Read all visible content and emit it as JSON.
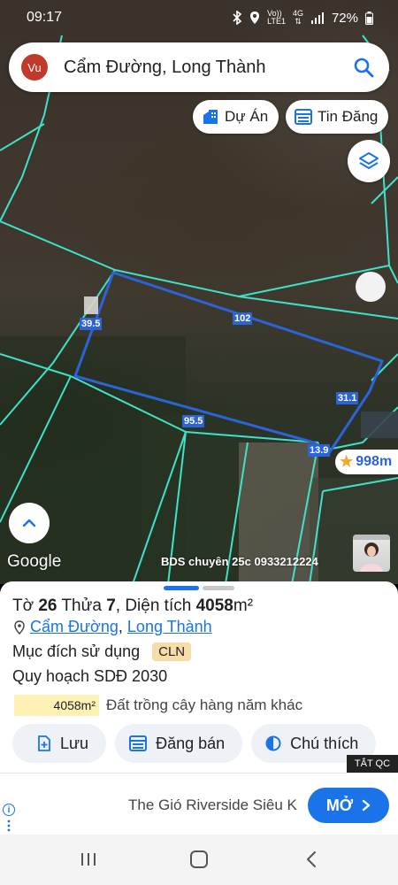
{
  "status_bar": {
    "time": "09:17",
    "network_top": "Vo))",
    "network_bottom": "LTE1",
    "data_type": "4G",
    "battery": "72%"
  },
  "search": {
    "avatar_initials": "Vu",
    "query": "Cẩm Đường, Long Thành"
  },
  "chips": {
    "projects": "Dự Án",
    "listings": "Tin Đăng"
  },
  "map": {
    "lengths": {
      "top": "102",
      "left": "39.5",
      "bottom": "95.5",
      "right": "31.1",
      "corner": "13.9"
    },
    "price_tag": "998m",
    "google_logo": "Google",
    "attribution": "BDS chuyên 25c 0933212224"
  },
  "parcel": {
    "sheet_label": "Tờ",
    "sheet_no": "26",
    "plot_label": "Thửa",
    "plot_no": "7",
    "area_label": "Diện tích",
    "area_value": "4058",
    "area_unit": "m²",
    "commune": "Cẩm Đường",
    "district": "Long Thành",
    "separator": ",",
    "purpose_label": "Mục đích sử dụng",
    "purpose_code": "CLN",
    "plan_label": "Quy hoạch SDĐ 2030",
    "plan_area": "4058m²",
    "plan_desc": "Đất trồng cây hàng năm khác"
  },
  "actions": {
    "save": "Lưu",
    "post_sale": "Đăng bán",
    "legend": "Chú thích"
  },
  "ad": {
    "close_label": "TẮT QC",
    "text": "The Gió Riverside Siêu K",
    "cta": "MỞ"
  },
  "colors": {
    "boundary": "#3ee2c8",
    "highlight": "#2b63d8",
    "accent": "#1a73e8",
    "badge": "#f8dca8",
    "area_badge": "#fdf1b5"
  }
}
